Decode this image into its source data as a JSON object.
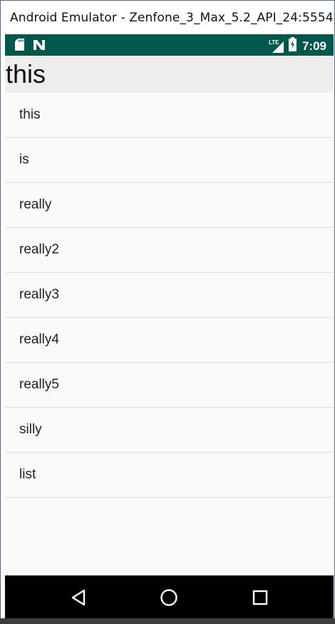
{
  "window": {
    "title": "Android Emulator - Zenfone_3_Max_5.2_API_24:5554"
  },
  "statusbar": {
    "left_icons": [
      "sd-card-icon",
      "n-notification-icon"
    ],
    "network_label": "LTE",
    "time": "7:09",
    "color": "#00574b"
  },
  "appbar": {
    "title": "this"
  },
  "list": {
    "items": [
      "this",
      "is",
      "really",
      "really2",
      "really3",
      "really4",
      "really5",
      "silly",
      "list"
    ]
  },
  "navbar": {
    "buttons": [
      "back-icon",
      "home-icon",
      "recents-icon"
    ]
  }
}
